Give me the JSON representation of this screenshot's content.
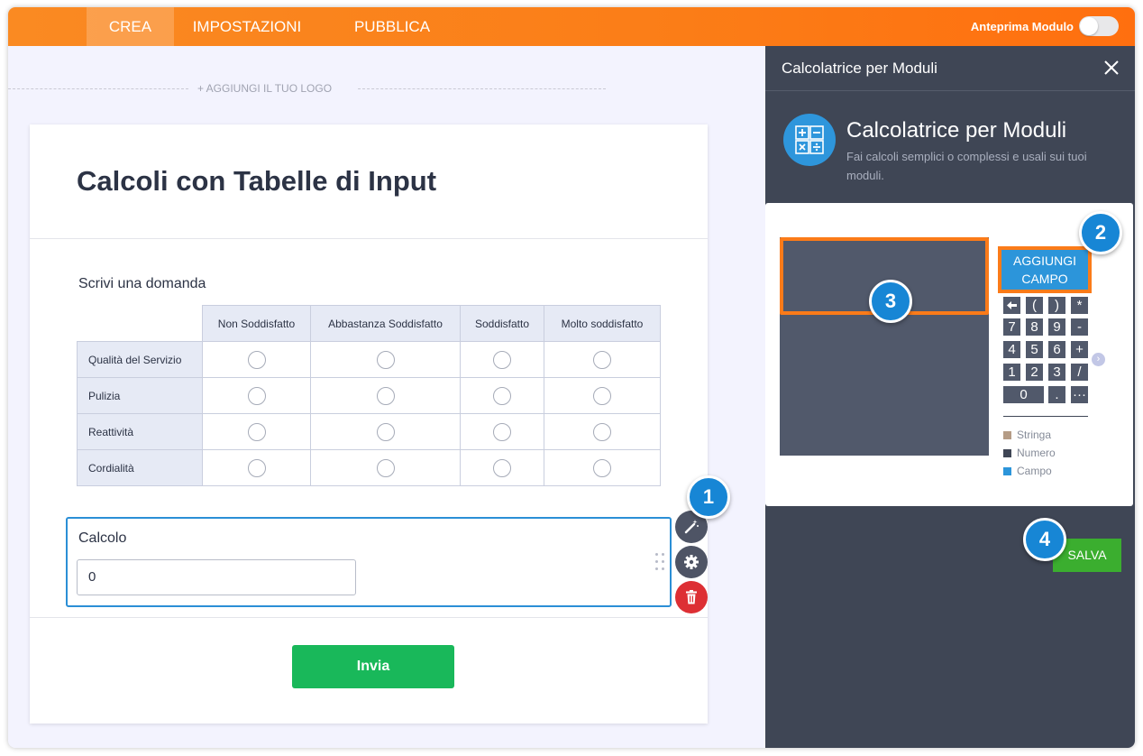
{
  "topbar": {
    "tabs": [
      "CREA",
      "IMPOSTAZIONI",
      "PUBBLICA"
    ],
    "preview_label": "Anteprima Modulo"
  },
  "logo": {
    "add_label": "+ AGGIUNGI IL TUO LOGO"
  },
  "form": {
    "title": "Calcoli con Tabelle di Input",
    "question": "Scrivi una domanda",
    "matrix": {
      "columns": [
        "Non Soddisfatto",
        "Abbastanza Soddisfatto",
        "Soddisfatto",
        "Molto soddisfatto"
      ],
      "rows": [
        "Qualità del Servizio",
        "Pulizia",
        "Reattività",
        "Cordialità"
      ]
    },
    "calc_field": {
      "label": "Calcolo",
      "value": "0"
    },
    "submit_label": "Invia"
  },
  "panel": {
    "header_title": "Calcolatrice per Moduli",
    "app_name": "Calcolatrice per Moduli",
    "app_description": "Fai calcoli semplici o complessi e usali sui tuoi moduli.",
    "add_field_label": "AGGIUNGI CAMPO",
    "keys": [
      [
        "🡐",
        "(",
        ")",
        "*"
      ],
      [
        "7",
        "8",
        "9",
        "-"
      ],
      [
        "4",
        "5",
        "6",
        "+"
      ],
      [
        "1",
        "2",
        "3",
        "/"
      ],
      [
        "0",
        ".",
        "···"
      ]
    ],
    "legend": [
      {
        "label": "Stringa",
        "color": "#b59c86"
      },
      {
        "label": "Numero",
        "color": "#3f4655"
      },
      {
        "label": "Campo",
        "color": "#2c95da"
      }
    ],
    "save_label": "SALVA"
  },
  "badges": [
    "1",
    "2",
    "3",
    "4"
  ],
  "colors": {
    "accent_orange": "#fb7d17",
    "accent_blue": "#1786d5",
    "submit_green": "#19b85a",
    "delete_red": "#dd2f34"
  }
}
